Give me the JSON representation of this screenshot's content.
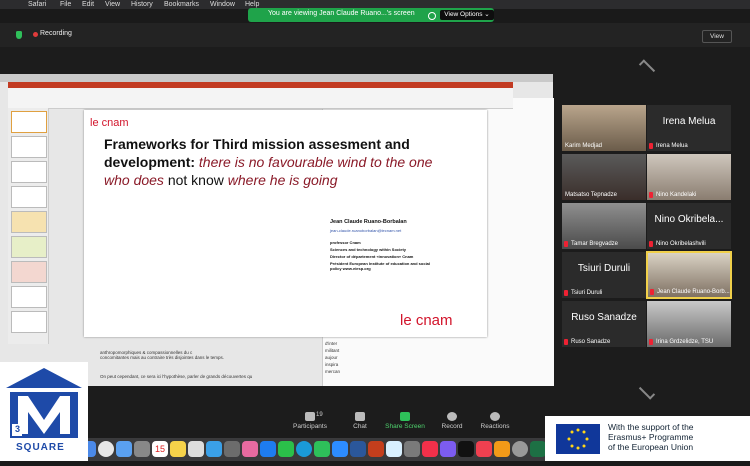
{
  "menubar": {
    "items": [
      "Safari",
      "File",
      "Edit",
      "View",
      "History",
      "Bookmarks",
      "Window",
      "Help"
    ]
  },
  "banner": {
    "text": "You are viewing Jean Claude Ruano...'s screen",
    "view_options": "View Options ⌄"
  },
  "meeting": {
    "recording": "Recording",
    "view": "View"
  },
  "slide": {
    "logo": "le cnam",
    "title_line1": "Frameworks for Third mission assesment and",
    "title_line2_bold": "development:",
    "title_line2_italic": " there is no favourable wind to the one",
    "title_line3_italic_a": "who does",
    "title_line3_plain_a": " not know ",
    "title_line3_italic_b": "where he is going",
    "author": "Jean Claude Ruano-Borbalan",
    "email": "jean-claude.ruanoborbalan@lecnam.net",
    "roles": [
      "professor Cnam",
      "Sciences and technology within Society",
      "Director of  département «innovation» Cnam",
      "Président European Institute of education and social policy www.eiesp.org"
    ],
    "logo_bottom": "le cnam"
  },
  "background_doc": {
    "line1": "anthropomorphiques & compassionnelles du c",
    "line2": "concomitantes mais au contraire très disjointes dans le temps.",
    "line3": "On peut cependant, ce sera ici l'hypothèse, parler de grands découvertes qu",
    "side": "d'inter militant aujour inspira mercan"
  },
  "participants": [
    {
      "name": "Karim Medjad",
      "video": true,
      "muted": false
    },
    {
      "name": "Irena Melua",
      "video": false,
      "muted": true
    },
    {
      "name": "Matsatso Tepnadze",
      "video": true,
      "muted": false
    },
    {
      "name": "Nino Kandelaki",
      "video": true,
      "muted": true
    },
    {
      "name": "Tamar Bregvadze",
      "video": true,
      "muted": true
    },
    {
      "name": "Nino Okribelashvili",
      "big": "Nino Okribela...",
      "video": false,
      "muted": true
    },
    {
      "name": "Tsiuri Duruli",
      "big": "Tsiuri Duruli",
      "video": false,
      "muted": true
    },
    {
      "name": "Jean Claude Ruano-Borb...",
      "video": true,
      "muted": false,
      "active": true
    },
    {
      "name": "Ruso Sanadze",
      "big": "Ruso Sanadze",
      "video": false,
      "muted": true
    },
    {
      "name": "Irina Grdzelidze, TSU",
      "video": true,
      "muted": true
    }
  ],
  "controls": {
    "participants": "Participants",
    "participants_count": "19",
    "chat": "Chat",
    "share": "Share Screen",
    "record": "Record",
    "reactions": "Reactions"
  },
  "dock": {
    "calendar_day": "15"
  },
  "eu": {
    "line1": "With the support of the",
    "line2": "Erasmus+ Programme",
    "line3": "of the European Union"
  },
  "m3": {
    "label": "SQUARE",
    "number": "3"
  },
  "colors": {
    "brand_red": "#d2142b",
    "zoom_green": "#1fa34a",
    "eu_blue": "#10379a"
  }
}
